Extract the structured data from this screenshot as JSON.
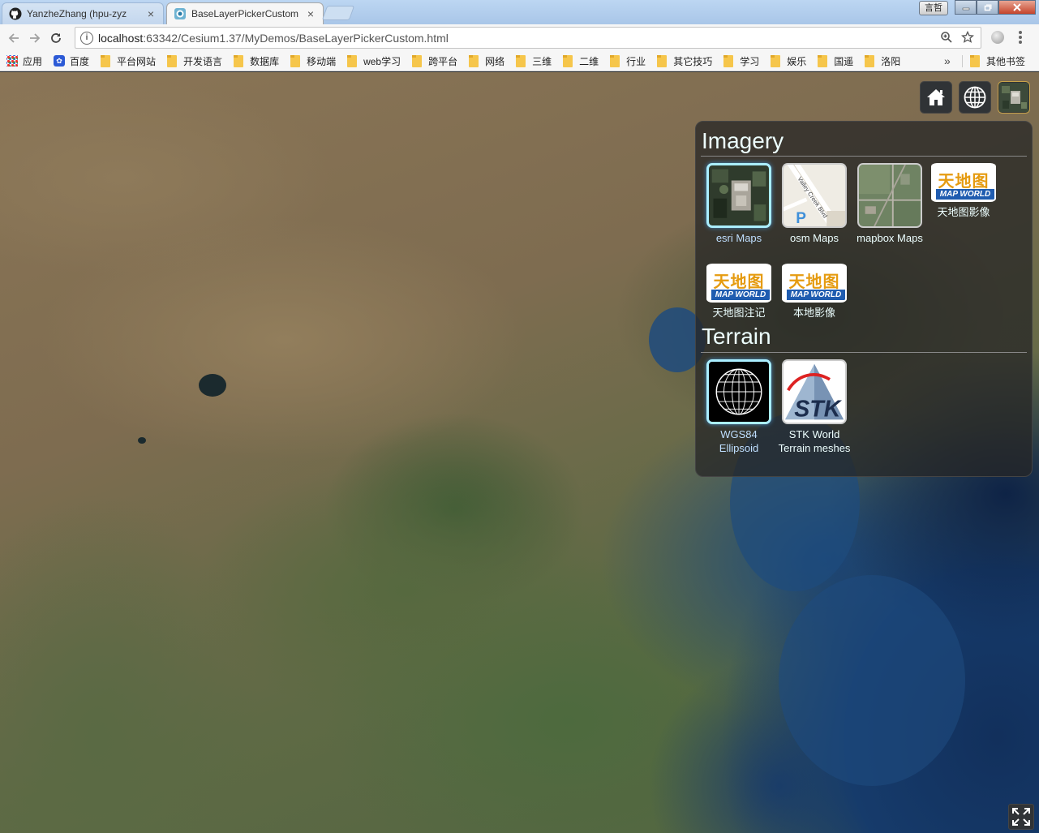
{
  "browser": {
    "tabs": [
      {
        "title": "YanzheZhang (hpu-zyz",
        "icon": "github-icon"
      },
      {
        "title": "BaseLayerPickerCustom",
        "icon": "cesium-icon",
        "active": true
      }
    ],
    "user_label": "言哲",
    "address": {
      "host": "localhost",
      "path": ":63342/Cesium1.37/MyDemos/BaseLayerPickerCustom.html"
    },
    "bookmarks": [
      "应用",
      "百度",
      "平台网站",
      "开发语言",
      "数据库",
      "移动端",
      "web学习",
      "跨平台",
      "网络",
      "三维",
      "二维",
      "行业",
      "其它技巧",
      "学习",
      "娱乐",
      "国遥",
      "洛阳"
    ],
    "bookmarks_overflow": "»",
    "other_bookmarks": "其他书签"
  },
  "picker": {
    "imagery_title": "Imagery",
    "imagery": [
      {
        "label": "esri Maps",
        "selected": true
      },
      {
        "label": "osm Maps"
      },
      {
        "label": "mapbox Maps"
      },
      {
        "label": "天地图影像"
      },
      {
        "label": "天地图注记"
      },
      {
        "label": "本地影像"
      }
    ],
    "tianditu_logo": {
      "cn": "天地图",
      "en": "MAP WORLD"
    },
    "osm_street": "Valley Creek Blvd",
    "osm_marker": "P",
    "terrain_title": "Terrain",
    "terrain": [
      {
        "label": "WGS84 Ellipsoid",
        "selected": true
      },
      {
        "label": "STK World Terrain meshes"
      }
    ],
    "stk_logo": "STK"
  },
  "colors": {
    "accent": "#aaeeff",
    "panel": "#262626",
    "selected_label": "#bfdfff"
  }
}
